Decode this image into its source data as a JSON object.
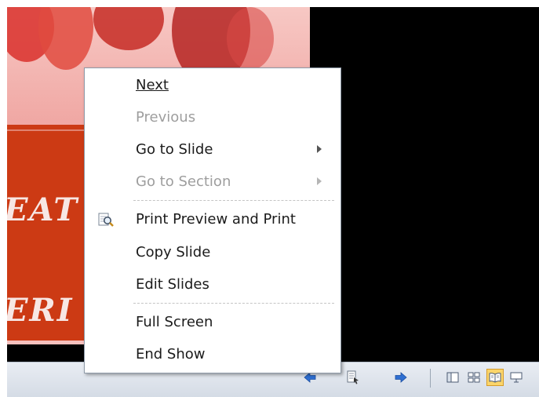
{
  "menu": {
    "items": [
      {
        "label": "Next",
        "enabled": true,
        "submenu": false
      },
      {
        "label": "Previous",
        "enabled": false,
        "submenu": false
      },
      {
        "label": "Go to Slide",
        "enabled": true,
        "submenu": true
      },
      {
        "label": "Go to Section",
        "enabled": false,
        "submenu": true
      },
      {
        "label": "Print Preview and Print",
        "enabled": true,
        "submenu": false,
        "icon": "print-preview-icon"
      },
      {
        "label": "Copy Slide",
        "enabled": true,
        "submenu": false
      },
      {
        "label": "Edit Slides",
        "enabled": true,
        "submenu": false
      },
      {
        "label": "Full Screen",
        "enabled": true,
        "submenu": false
      },
      {
        "label": "End Show",
        "enabled": true,
        "submenu": false
      }
    ]
  },
  "slide": {
    "text_line1": "EAT",
    "text_line2": "ERI"
  },
  "controls": {
    "prev_icon": "arrow-left-icon",
    "menu_icon": "slide-menu-icon",
    "next_icon": "arrow-right-icon",
    "view_normal_icon": "normal-view-icon",
    "view_sorter_icon": "slide-sorter-icon",
    "view_reading_icon": "reading-view-icon",
    "view_slideshow_icon": "slideshow-view-icon"
  },
  "colors": {
    "menu_text": "#1b1b1b",
    "menu_disabled": "#9e9e9e",
    "active_view": "#fbd56a",
    "nav_arrow": "#2a63c6"
  }
}
